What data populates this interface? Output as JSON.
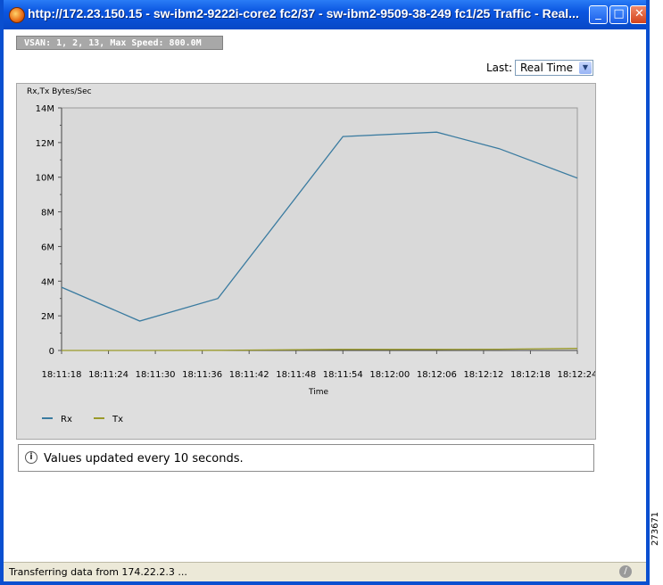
{
  "window": {
    "title": "http://172.23.150.15 - sw-ibm2-9222i-core2 fc2/37 - sw-ibm2-9509-38-249 fc1/25 Traffic - Real...",
    "buttons": {
      "minimize": "_",
      "maximize": "□",
      "close": "✕"
    }
  },
  "vsan_label": "VSAN: 1, 2, 13, Max Speed: 800.0M",
  "last": {
    "label": "Last:",
    "selected": "Real Time"
  },
  "chart_data": {
    "type": "line",
    "ylabel": "Rx,Tx Bytes/Sec",
    "xlabel": "Time",
    "ylim": [
      0,
      14000000
    ],
    "y_ticks": [
      "0",
      "2M",
      "4M",
      "6M",
      "8M",
      "10M",
      "12M",
      "14M"
    ],
    "x_ticks": [
      "18:11:18",
      "18:11:24",
      "18:11:30",
      "18:11:36",
      "18:11:42",
      "18:11:48",
      "18:11:54",
      "18:12:00",
      "18:12:06",
      "18:12:12",
      "18:12:18",
      "18:12:24"
    ],
    "grid": true,
    "legend_position": "bottom-left",
    "series": [
      {
        "name": "Rx",
        "color": "#3a7ba0",
        "points": [
          [
            "18:11:18",
            3650000
          ],
          [
            "18:11:28",
            1700000
          ],
          [
            "18:11:38",
            3000000
          ],
          [
            "18:11:54",
            12350000
          ],
          [
            "18:12:06",
            12600000
          ],
          [
            "18:12:14",
            11650000
          ],
          [
            "18:12:24",
            9950000
          ]
        ]
      },
      {
        "name": "Tx",
        "color": "#9a9a2a",
        "points": [
          [
            "18:11:18",
            0
          ],
          [
            "18:11:28",
            0
          ],
          [
            "18:11:38",
            10000
          ],
          [
            "18:11:54",
            60000
          ],
          [
            "18:12:06",
            60000
          ],
          [
            "18:12:14",
            70000
          ],
          [
            "18:12:24",
            120000
          ]
        ]
      }
    ]
  },
  "info": {
    "text": "Values updated every 10 seconds."
  },
  "status": {
    "text": "Transferring data from 174.22.2.3 ..."
  },
  "side_id": "273671"
}
